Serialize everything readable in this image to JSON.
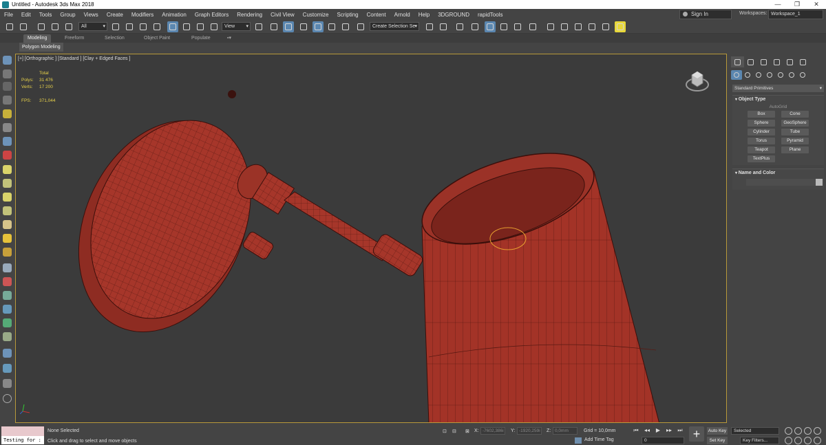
{
  "window": {
    "title": "Untitled - Autodesk 3ds Max 2018",
    "controls": [
      "—",
      "❐",
      "✕"
    ]
  },
  "menu": {
    "items": [
      "File",
      "Edit",
      "Tools",
      "Group",
      "Views",
      "Create",
      "Modifiers",
      "Animation",
      "Graph Editors",
      "Rendering",
      "Civil View",
      "Customize",
      "Scripting",
      "Content",
      "Arnold",
      "Help",
      "3DGROUND",
      "rapidTools"
    ],
    "sign_in": "Sign In",
    "workspaces_label": "Workspaces:",
    "workspace_value": "Workspace_1"
  },
  "toolbar": {
    "selection_filter": "All",
    "ref_coord": "View",
    "named_selection": "Create Selection Se"
  },
  "ribbon": {
    "tabs": [
      "Modeling",
      "Freeform",
      "Selection",
      "Object Paint",
      "Populate"
    ],
    "active_tab": "Modeling",
    "panel_label": "Polygon Modeling"
  },
  "viewport": {
    "label": "[+] [Orthographic ] [Standard ] [Clay + Edged Faces ]",
    "stats": {
      "total_label": "Total",
      "polys_label": "Polys:",
      "polys_value": "31 476",
      "verts_label": "Verts:",
      "verts_value": "17 200",
      "fps_label": "FPS:",
      "fps_value": "371,044"
    },
    "colors": {
      "model": "#a6362a",
      "wire": "#4a130e",
      "bulb": "#e8a030",
      "frame": "#b99a3a"
    }
  },
  "command_panel": {
    "category": "Standard Primitives",
    "object_type": {
      "title": "Object Type",
      "autogrid": "AutoGrid",
      "buttons": [
        "Box",
        "Cone",
        "Sphere",
        "GeoSphere",
        "Cylinder",
        "Tube",
        "Torus",
        "Pyramid",
        "Teapot",
        "Plane",
        "TextPlus"
      ]
    },
    "name_and_color": {
      "title": "Name and Color"
    }
  },
  "status": {
    "maxscript_input": "Testing for :",
    "selection_text": "None Selected",
    "prompt_text": "Click and drag to select and move objects",
    "x_label": "X:",
    "x_value": "-7602,386i",
    "y_label": "Y:",
    "y_value": "-1920,259i",
    "z_label": "Z:",
    "z_value": "0,0mm",
    "grid": "Grid = 10,0mm",
    "add_time_tag": "Add Time Tag",
    "frame_value": "0",
    "auto_key": "Auto Key",
    "set_key": "Set Key",
    "key_mode": "Selected",
    "key_filters": "Key Filters..."
  }
}
